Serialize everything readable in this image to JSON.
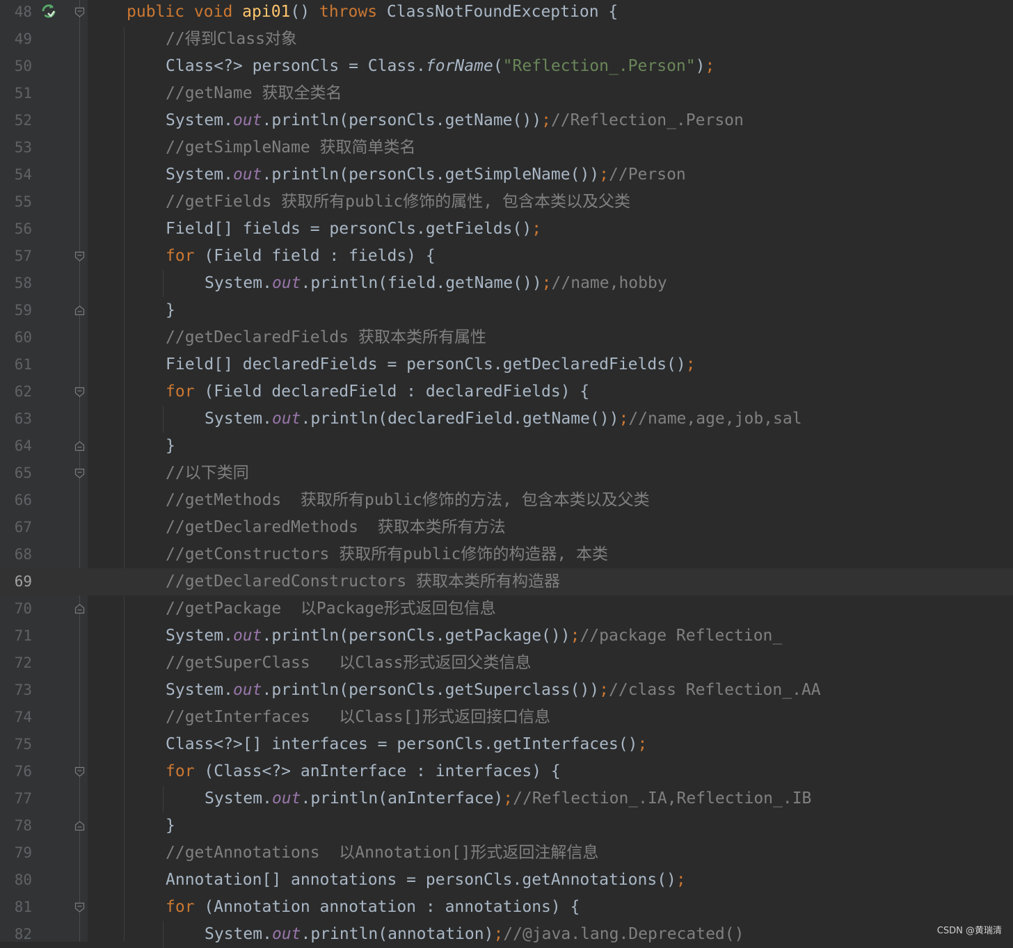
{
  "editor": {
    "current_line": 69,
    "lines": [
      {
        "n": "48",
        "indent": 182,
        "fold": "start",
        "run": true,
        "parts": [
          [
            "kw",
            "public void "
          ],
          [
            "fn",
            "api01"
          ],
          [
            "",
            "() "
          ],
          [
            "kw",
            "throws "
          ],
          [
            "",
            "ClassNotFoundException {"
          ]
        ]
      },
      {
        "n": "49",
        "indent": 238,
        "parts": [
          [
            "cm",
            "//得到Class对象"
          ]
        ]
      },
      {
        "n": "50",
        "indent": 238,
        "parts": [
          [
            "",
            "Class<?> personCls = Class."
          ],
          [
            "it",
            "forName"
          ],
          [
            "",
            "("
          ],
          [
            "st",
            "\"Reflection_.Person\""
          ],
          [
            "",
            ")"
          ],
          [
            "semi",
            ";"
          ]
        ]
      },
      {
        "n": "51",
        "indent": 238,
        "parts": [
          [
            "cm",
            "//getName 获取全类名"
          ]
        ]
      },
      {
        "n": "52",
        "indent": 238,
        "parts": [
          [
            "",
            "System."
          ],
          [
            "st-fld",
            "out"
          ],
          [
            "",
            ".println(personCls.getName())"
          ],
          [
            "semi",
            ";"
          ],
          [
            "cm",
            "//Reflection_.Person"
          ]
        ]
      },
      {
        "n": "53",
        "indent": 238,
        "parts": [
          [
            "cm",
            "//getSimpleName 获取简单类名"
          ]
        ]
      },
      {
        "n": "54",
        "indent": 238,
        "parts": [
          [
            "",
            "System."
          ],
          [
            "st-fld",
            "out"
          ],
          [
            "",
            ".println(personCls.getSimpleName())"
          ],
          [
            "semi",
            ";"
          ],
          [
            "cm",
            "//Person"
          ]
        ]
      },
      {
        "n": "55",
        "indent": 238,
        "parts": [
          [
            "cm",
            "//getFields 获取所有public修饰的属性, 包含本类以及父类"
          ]
        ]
      },
      {
        "n": "56",
        "indent": 238,
        "parts": [
          [
            "",
            "Field[] fields = personCls.getFields()"
          ],
          [
            "semi",
            ";"
          ]
        ]
      },
      {
        "n": "57",
        "indent": 238,
        "fold": "start",
        "parts": [
          [
            "kw",
            "for "
          ],
          [
            "",
            "(Field field : fields) {"
          ]
        ]
      },
      {
        "n": "58",
        "indent": 294,
        "parts": [
          [
            "",
            "System."
          ],
          [
            "st-fld",
            "out"
          ],
          [
            "",
            ".println(field.getName())"
          ],
          [
            "semi",
            ";"
          ],
          [
            "cm",
            "//name,hobby"
          ]
        ]
      },
      {
        "n": "59",
        "indent": 238,
        "fold": "end",
        "parts": [
          [
            "",
            "}"
          ]
        ]
      },
      {
        "n": "60",
        "indent": 238,
        "parts": [
          [
            "cm",
            "//getDeclaredFields 获取本类所有属性"
          ]
        ]
      },
      {
        "n": "61",
        "indent": 238,
        "parts": [
          [
            "",
            "Field[] declaredFields = personCls.getDeclaredFields()"
          ],
          [
            "semi",
            ";"
          ]
        ]
      },
      {
        "n": "62",
        "indent": 238,
        "fold": "start",
        "parts": [
          [
            "kw",
            "for "
          ],
          [
            "",
            "(Field declaredField : declaredFields) {"
          ]
        ]
      },
      {
        "n": "63",
        "indent": 294,
        "parts": [
          [
            "",
            "System."
          ],
          [
            "st-fld",
            "out"
          ],
          [
            "",
            ".println(declaredField.getName())"
          ],
          [
            "semi",
            ";"
          ],
          [
            "cm",
            "//name,age,job,sal"
          ]
        ]
      },
      {
        "n": "64",
        "indent": 238,
        "fold": "end",
        "parts": [
          [
            "",
            "}"
          ]
        ]
      },
      {
        "n": "65",
        "indent": 238,
        "fold": "start",
        "parts": [
          [
            "cm",
            "//以下类同"
          ]
        ]
      },
      {
        "n": "66",
        "indent": 238,
        "parts": [
          [
            "cm",
            "//getMethods  获取所有public修饰的方法, 包含本类以及父类"
          ]
        ]
      },
      {
        "n": "67",
        "indent": 238,
        "parts": [
          [
            "cm",
            "//getDeclaredMethods  获取本类所有方法"
          ]
        ]
      },
      {
        "n": "68",
        "indent": 238,
        "parts": [
          [
            "cm",
            "//getConstructors 获取所有public修饰的构造器, 本类"
          ]
        ]
      },
      {
        "n": "69",
        "indent": 238,
        "parts": [
          [
            "cm",
            "//getDeclaredConstructors 获取本类所有构造器"
          ]
        ]
      },
      {
        "n": "70",
        "indent": 238,
        "fold": "end",
        "parts": [
          [
            "cm",
            "//getPackage  以Package形式返回包信息"
          ]
        ]
      },
      {
        "n": "71",
        "indent": 238,
        "parts": [
          [
            "",
            "System."
          ],
          [
            "st-fld",
            "out"
          ],
          [
            "",
            ".println(personCls.getPackage())"
          ],
          [
            "semi",
            ";"
          ],
          [
            "cm",
            "//package Reflection_"
          ]
        ]
      },
      {
        "n": "72",
        "indent": 238,
        "parts": [
          [
            "cm",
            "//getSuperClass   以Class形式返回父类信息"
          ]
        ]
      },
      {
        "n": "73",
        "indent": 238,
        "parts": [
          [
            "",
            "System."
          ],
          [
            "st-fld",
            "out"
          ],
          [
            "",
            ".println(personCls.getSuperclass())"
          ],
          [
            "semi",
            ";"
          ],
          [
            "cm",
            "//class Reflection_.AA"
          ]
        ]
      },
      {
        "n": "74",
        "indent": 238,
        "parts": [
          [
            "cm",
            "//getInterfaces   以Class[]形式返回接口信息"
          ]
        ]
      },
      {
        "n": "75",
        "indent": 238,
        "parts": [
          [
            "",
            "Class<?>[] interfaces = personCls.getInterfaces()"
          ],
          [
            "semi",
            ";"
          ]
        ]
      },
      {
        "n": "76",
        "indent": 238,
        "fold": "start",
        "parts": [
          [
            "kw",
            "for "
          ],
          [
            "",
            "(Class<?> anInterface : interfaces) {"
          ]
        ]
      },
      {
        "n": "77",
        "indent": 294,
        "parts": [
          [
            "",
            "System."
          ],
          [
            "st-fld",
            "out"
          ],
          [
            "",
            ".println(anInterface)"
          ],
          [
            "semi",
            ";"
          ],
          [
            "cm",
            "//Reflection_.IA,Reflection_.IB"
          ]
        ]
      },
      {
        "n": "78",
        "indent": 238,
        "fold": "end",
        "parts": [
          [
            "",
            "}"
          ]
        ]
      },
      {
        "n": "79",
        "indent": 238,
        "parts": [
          [
            "cm",
            "//getAnnotations  以Annotation[]形式返回注解信息"
          ]
        ]
      },
      {
        "n": "80",
        "indent": 238,
        "parts": [
          [
            "",
            "Annotation[] annotations = personCls.getAnnotations()"
          ],
          [
            "semi",
            ";"
          ]
        ]
      },
      {
        "n": "81",
        "indent": 238,
        "fold": "start",
        "parts": [
          [
            "kw",
            "for "
          ],
          [
            "",
            "(Annotation annotation : annotations) {"
          ]
        ]
      },
      {
        "n": "82",
        "indent": 294,
        "parts": [
          [
            "",
            "System."
          ],
          [
            "st-fld",
            "out"
          ],
          [
            "",
            ".println(annotation)"
          ],
          [
            "semi",
            ";"
          ],
          [
            "cm",
            "//@java.lang.Deprecated()"
          ]
        ]
      }
    ]
  },
  "watermark": "CSDN @黄瑞清",
  "colors": {
    "background": "#2b2b2b",
    "gutter": "#313335",
    "keyword": "#cc7832",
    "comment": "#808080",
    "string": "#6a8759",
    "method_decl": "#ffc66d",
    "static_field": "#9876aa",
    "default": "#a9b7c6",
    "run_icon": "#59a869"
  },
  "icons": {
    "run": "run-gutter-icon",
    "fold_start": "fold-start-icon",
    "fold_end": "fold-end-icon"
  }
}
